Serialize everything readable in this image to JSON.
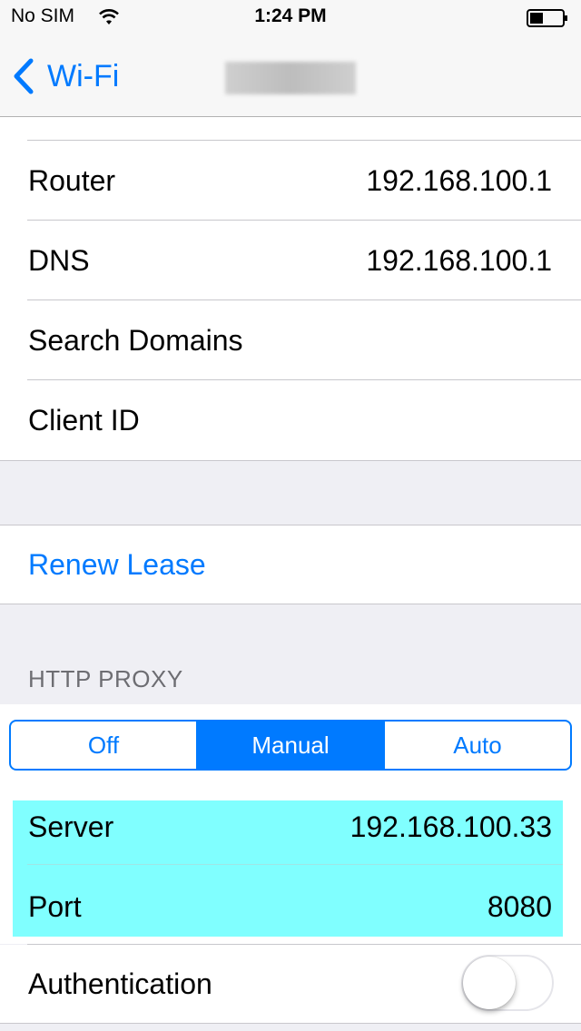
{
  "status_bar": {
    "carrier": "No SIM",
    "time": "1:24 PM",
    "icons": [
      "wifi-icon",
      "battery-icon"
    ]
  },
  "nav": {
    "back_label": "Wi-Fi",
    "back_icon": "chevron-left-icon",
    "title_redacted": true
  },
  "ip_section": {
    "rows": [
      {
        "label": "Router",
        "value": "192.168.100.1"
      },
      {
        "label": "DNS",
        "value": "192.168.100.1"
      },
      {
        "label": "Search Domains",
        "value": ""
      },
      {
        "label": "Client ID",
        "value": ""
      }
    ]
  },
  "renew": {
    "label": "Renew Lease"
  },
  "http_proxy": {
    "header": "HTTP PROXY",
    "segments": [
      "Off",
      "Manual",
      "Auto"
    ],
    "selected": "Manual",
    "rows": [
      {
        "label": "Server",
        "value": "192.168.100.33"
      },
      {
        "label": "Port",
        "value": "8080"
      }
    ],
    "authentication_label": "Authentication",
    "authentication_on": false
  },
  "colors": {
    "accent": "#007aff",
    "background": "#efeff4",
    "highlight": "#80ffff"
  }
}
